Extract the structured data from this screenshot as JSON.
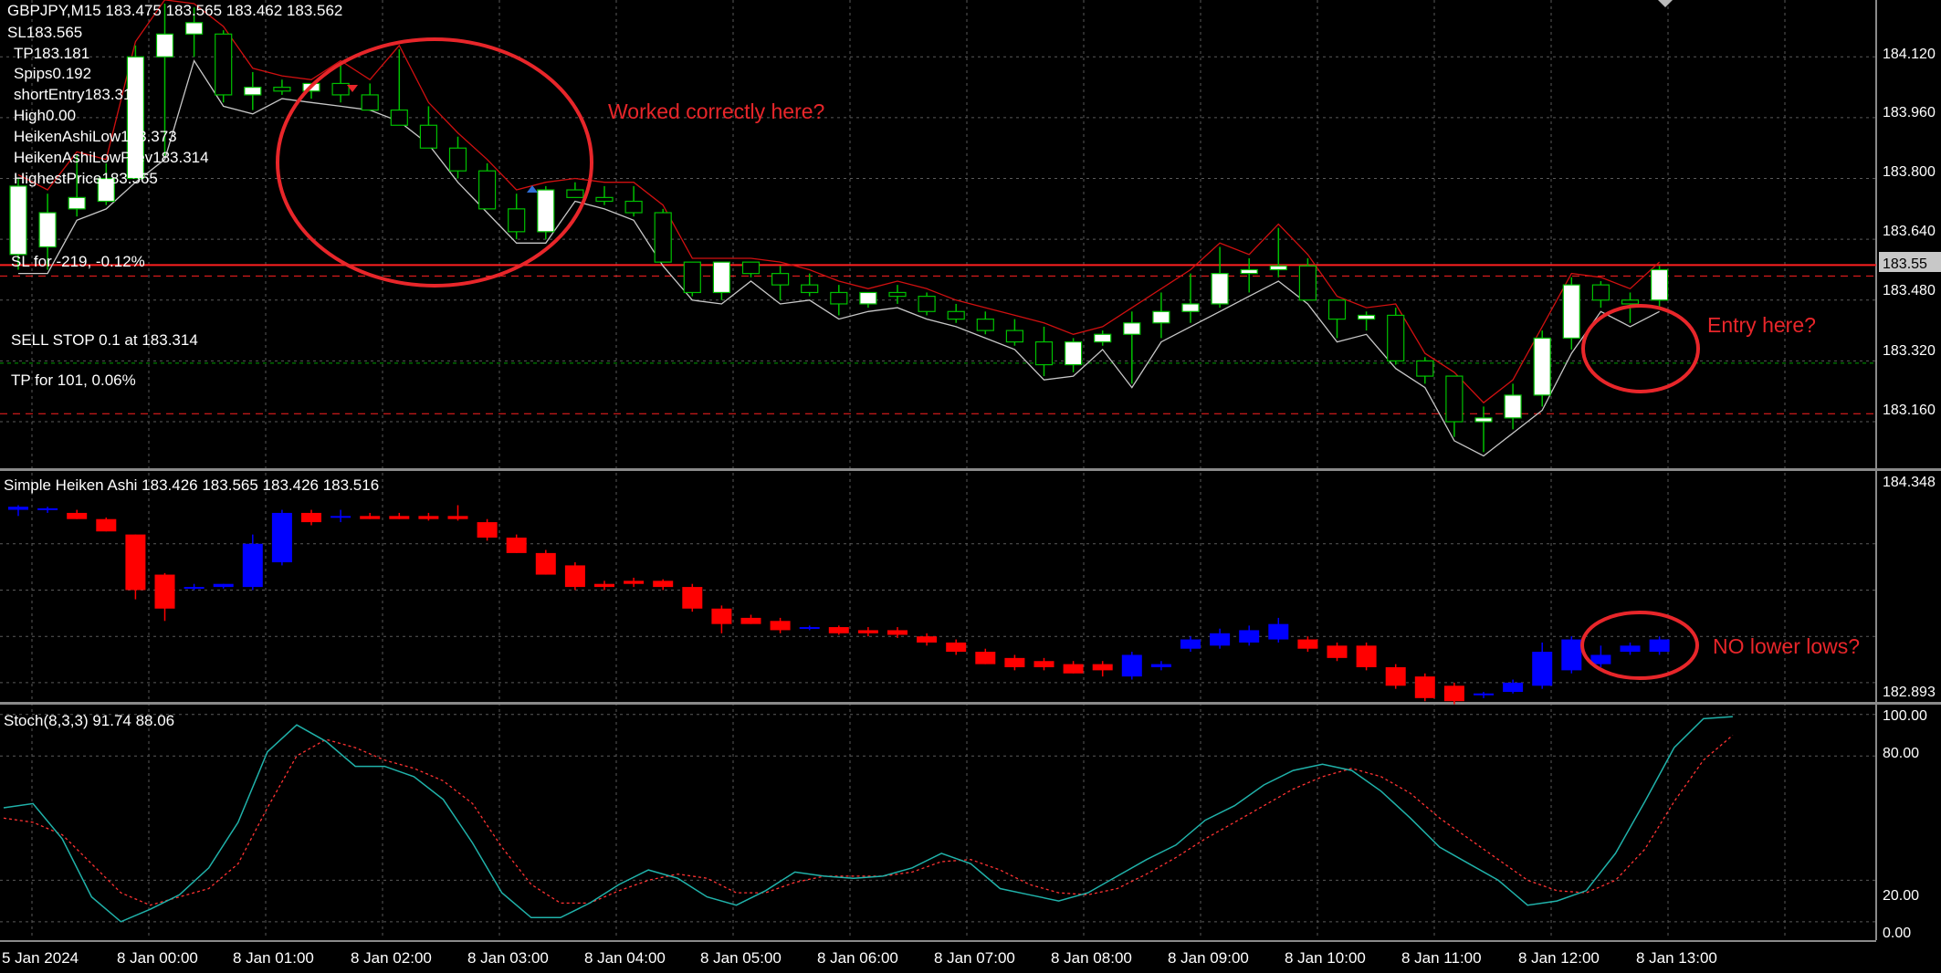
{
  "main_pane": {
    "header": "GBPJPY,M15  183.475 183.565 183.462 183.562",
    "info_lines": [
      "SL183.565",
      "TP183.181",
      "Spips0.192",
      "shortEntry183.314",
      "High0.00",
      "HeikenAshiLow183.373",
      "HeikenAshiLowPrev183.314",
      "HighestPrice183.565"
    ],
    "sl_label": "SL for -219, -0.12%",
    "sell_stop_label": "SELL STOP 0.1 at 183.314",
    "tp_label": "TP for 101, 0.06%",
    "price_badge": "183.55",
    "price_axis": [
      "184.120",
      "183.960",
      "183.800",
      "183.640",
      "183.480",
      "183.320",
      "183.160"
    ],
    "annotations": [
      "Worked correctly here?",
      "Entry here?"
    ]
  },
  "ha_pane": {
    "header": "Simple Heiken Ashi 183.426 183.565 183.426 183.516",
    "axis": [
      "184.348",
      "182.893"
    ],
    "annotation": "NO lower lows?"
  },
  "stoch_pane": {
    "header": "Stoch(8,3,3) 91.74 88.06",
    "axis": [
      "100.00",
      "80.00",
      "20.00",
      "0.00"
    ]
  },
  "time_axis": [
    "5 Jan 2024",
    "8 Jan 00:00",
    "8 Jan 01:00",
    "8 Jan 02:00",
    "8 Jan 03:00",
    "8 Jan 04:00",
    "8 Jan 05:00",
    "8 Jan 06:00",
    "8 Jan 07:00",
    "8 Jan 08:00",
    "8 Jan 09:00",
    "8 Jan 10:00",
    "8 Jan 11:00",
    "8 Jan 12:00",
    "8 Jan 13:00"
  ],
  "colors": {
    "background": "#000000",
    "grid": "#5a5a5a",
    "annotation": "#e8262a",
    "bull_candle": "#ffffff",
    "candle_outline": "#00c000",
    "ha_bull": "#0000ff",
    "ha_bear": "#ff0000",
    "stoch_main": "#20b2aa",
    "stoch_signal": "#ff3333"
  },
  "chart_data": [
    {
      "type": "candlestick",
      "title": "GBPJPY,M15",
      "ylim": [
        183.04,
        184.26
      ],
      "y_ticks": [
        184.12,
        183.96,
        183.8,
        183.64,
        183.48,
        183.32,
        183.16
      ],
      "levels": {
        "sl": 183.565,
        "sell_stop": 183.314,
        "tp": 183.181
      },
      "ohlc": [
        [
          183.6,
          183.8,
          183.56,
          183.78
        ],
        [
          183.62,
          183.76,
          183.56,
          183.71
        ],
        [
          183.72,
          183.86,
          183.7,
          183.75
        ],
        [
          183.74,
          183.84,
          183.73,
          183.8
        ],
        [
          183.8,
          184.15,
          183.8,
          184.12
        ],
        [
          184.12,
          184.26,
          183.86,
          184.18
        ],
        [
          184.18,
          184.25,
          184.12,
          184.21
        ],
        [
          184.18,
          184.19,
          184.0,
          184.02
        ],
        [
          184.02,
          184.08,
          183.98,
          184.04
        ],
        [
          184.04,
          184.06,
          184.02,
          184.03
        ],
        [
          184.03,
          184.05,
          184.01,
          184.05
        ],
        [
          184.05,
          184.1,
          184.0,
          184.02
        ],
        [
          184.02,
          184.05,
          183.99,
          183.98
        ],
        [
          183.98,
          184.14,
          183.96,
          183.94
        ],
        [
          183.94,
          183.99,
          183.9,
          183.88
        ],
        [
          183.88,
          183.91,
          183.8,
          183.82
        ],
        [
          183.82,
          183.84,
          183.72,
          183.72
        ],
        [
          183.72,
          183.76,
          183.64,
          183.66
        ],
        [
          183.66,
          183.78,
          183.64,
          183.77
        ],
        [
          183.77,
          183.79,
          183.75,
          183.75
        ],
        [
          183.75,
          183.78,
          183.73,
          183.74
        ],
        [
          183.74,
          183.78,
          183.7,
          183.71
        ],
        [
          183.71,
          183.72,
          183.58,
          183.58
        ],
        [
          183.58,
          183.58,
          183.49,
          183.5
        ],
        [
          183.5,
          183.58,
          183.48,
          183.58
        ],
        [
          183.58,
          183.58,
          183.54,
          183.55
        ],
        [
          183.55,
          183.57,
          183.48,
          183.52
        ],
        [
          183.52,
          183.55,
          183.49,
          183.5
        ],
        [
          183.5,
          183.52,
          183.44,
          183.47
        ],
        [
          183.47,
          183.5,
          183.46,
          183.5
        ],
        [
          183.5,
          183.52,
          183.47,
          183.49
        ],
        [
          183.49,
          183.5,
          183.44,
          183.45
        ],
        [
          183.45,
          183.47,
          183.42,
          183.43
        ],
        [
          183.43,
          183.45,
          183.39,
          183.4
        ],
        [
          183.4,
          183.43,
          183.36,
          183.37
        ],
        [
          183.37,
          183.41,
          183.28,
          183.31
        ],
        [
          183.31,
          183.38,
          183.29,
          183.37
        ],
        [
          183.37,
          183.4,
          183.36,
          183.39
        ],
        [
          183.39,
          183.45,
          183.26,
          183.42
        ],
        [
          183.42,
          183.5,
          183.38,
          183.45
        ],
        [
          183.45,
          183.55,
          183.42,
          183.47
        ],
        [
          183.47,
          183.62,
          183.46,
          183.55
        ],
        [
          183.55,
          183.59,
          183.5,
          183.56
        ],
        [
          183.56,
          183.67,
          183.54,
          183.57
        ],
        [
          183.57,
          183.59,
          183.48,
          183.48
        ],
        [
          183.48,
          183.48,
          183.38,
          183.43
        ],
        [
          183.43,
          183.45,
          183.4,
          183.44
        ],
        [
          183.44,
          183.46,
          183.31,
          183.32
        ],
        [
          183.32,
          183.33,
          183.26,
          183.28
        ],
        [
          183.28,
          183.28,
          183.12,
          183.16
        ],
        [
          183.16,
          183.2,
          183.08,
          183.17
        ],
        [
          183.17,
          183.26,
          183.14,
          183.23
        ],
        [
          183.23,
          183.4,
          183.2,
          183.38
        ],
        [
          183.38,
          183.54,
          183.35,
          183.52
        ],
        [
          183.52,
          183.53,
          183.46,
          183.48
        ],
        [
          183.48,
          183.5,
          183.42,
          183.47
        ],
        [
          183.48,
          183.57,
          183.46,
          183.56
        ]
      ]
    },
    {
      "type": "heiken_ashi",
      "title": "Simple Heiken Ashi",
      "ylim": [
        182.893,
        184.348
      ],
      "ohlc": [
        [
          184.12,
          184.15,
          184.08,
          184.14
        ],
        [
          184.12,
          184.14,
          184.1,
          184.13
        ],
        [
          184.1,
          184.12,
          184.06,
          184.06
        ],
        [
          184.06,
          184.07,
          183.98,
          183.98
        ],
        [
          183.96,
          183.96,
          183.54,
          183.6
        ],
        [
          183.7,
          183.71,
          183.4,
          183.48
        ],
        [
          183.62,
          183.64,
          183.6,
          183.62
        ],
        [
          183.62,
          183.64,
          183.61,
          183.64
        ],
        [
          183.62,
          183.96,
          183.6,
          183.9
        ],
        [
          183.78,
          184.12,
          183.76,
          184.1
        ],
        [
          184.1,
          184.12,
          184.02,
          184.04
        ],
        [
          184.08,
          184.12,
          184.04,
          184.08
        ],
        [
          184.08,
          184.1,
          184.06,
          184.06
        ],
        [
          184.08,
          184.1,
          184.06,
          184.06
        ],
        [
          184.08,
          184.1,
          184.05,
          184.06
        ],
        [
          184.08,
          184.15,
          184.05,
          184.06
        ],
        [
          184.04,
          184.06,
          183.92,
          183.94
        ],
        [
          183.94,
          183.96,
          183.84,
          183.84
        ],
        [
          183.84,
          183.86,
          183.7,
          183.7
        ],
        [
          183.76,
          183.78,
          183.6,
          183.62
        ],
        [
          183.64,
          183.66,
          183.6,
          183.62
        ],
        [
          183.66,
          183.68,
          183.62,
          183.64
        ],
        [
          183.66,
          183.67,
          183.6,
          183.62
        ],
        [
          183.62,
          183.64,
          183.46,
          183.48
        ],
        [
          183.48,
          183.5,
          183.32,
          183.38
        ],
        [
          183.42,
          183.44,
          183.38,
          183.38
        ],
        [
          183.4,
          183.42,
          183.32,
          183.34
        ],
        [
          183.36,
          183.37,
          183.34,
          183.36
        ],
        [
          183.36,
          183.37,
          183.31,
          183.32
        ],
        [
          183.34,
          183.36,
          183.3,
          183.32
        ],
        [
          183.34,
          183.36,
          183.29,
          183.31
        ],
        [
          183.3,
          183.32,
          183.24,
          183.26
        ],
        [
          183.26,
          183.28,
          183.18,
          183.2
        ],
        [
          183.2,
          183.22,
          183.12,
          183.12
        ],
        [
          183.16,
          183.18,
          183.08,
          183.1
        ],
        [
          183.14,
          183.16,
          183.08,
          183.1
        ],
        [
          183.12,
          183.14,
          183.06,
          183.06
        ],
        [
          183.12,
          183.14,
          183.04,
          183.08
        ],
        [
          183.04,
          183.2,
          183.02,
          183.18
        ],
        [
          183.1,
          183.14,
          183.08,
          183.12
        ],
        [
          183.22,
          183.3,
          183.2,
          183.28
        ],
        [
          183.24,
          183.35,
          183.22,
          183.32
        ],
        [
          183.26,
          183.37,
          183.24,
          183.34
        ],
        [
          183.28,
          183.42,
          183.26,
          183.38
        ],
        [
          183.28,
          183.3,
          183.2,
          183.22
        ],
        [
          183.24,
          183.26,
          183.14,
          183.16
        ],
        [
          183.24,
          183.26,
          183.08,
          183.1
        ],
        [
          183.1,
          183.12,
          182.96,
          182.98
        ],
        [
          183.04,
          183.06,
          182.88,
          182.9
        ],
        [
          182.98,
          183.0,
          182.86,
          182.88
        ],
        [
          182.92,
          182.94,
          182.9,
          182.93
        ],
        [
          182.94,
          183.02,
          182.93,
          183.0
        ],
        [
          182.98,
          183.26,
          182.96,
          183.2
        ],
        [
          183.08,
          183.3,
          183.06,
          183.28
        ],
        [
          183.12,
          183.24,
          183.1,
          183.18
        ],
        [
          183.2,
          183.26,
          183.18,
          183.24
        ],
        [
          183.2,
          183.3,
          183.18,
          183.28
        ]
      ]
    },
    {
      "type": "line",
      "title": "Stoch(8,3,3)",
      "ylim": [
        -8,
        103
      ],
      "y_ticks": [
        100,
        80,
        20,
        0
      ],
      "series": [
        {
          "values": [
            55,
            57,
            40,
            12,
            0,
            6,
            13,
            26,
            48,
            82,
            95,
            87,
            75,
            75,
            70,
            59,
            38,
            14,
            2,
            2,
            9,
            18,
            25,
            21,
            12,
            8,
            15,
            24,
            22,
            21,
            22,
            26,
            33,
            28,
            16,
            13,
            10,
            14,
            22,
            30,
            37,
            49,
            56,
            66,
            73,
            76,
            73,
            63,
            50,
            36,
            28,
            20,
            8,
            10,
            15,
            33,
            58,
            84,
            98,
            99
          ]
        },
        {
          "values": [
            50,
            48,
            42,
            28,
            14,
            8,
            12,
            16,
            28,
            55,
            80,
            88,
            84,
            78,
            74,
            68,
            57,
            36,
            18,
            9,
            9,
            15,
            20,
            23,
            21,
            14,
            14,
            19,
            22,
            22,
            22,
            24,
            29,
            30,
            25,
            18,
            14,
            13,
            16,
            23,
            31,
            40,
            48,
            56,
            64,
            70,
            74,
            70,
            62,
            50,
            40,
            30,
            20,
            15,
            14,
            20,
            35,
            58,
            78,
            90
          ]
        }
      ]
    }
  ]
}
